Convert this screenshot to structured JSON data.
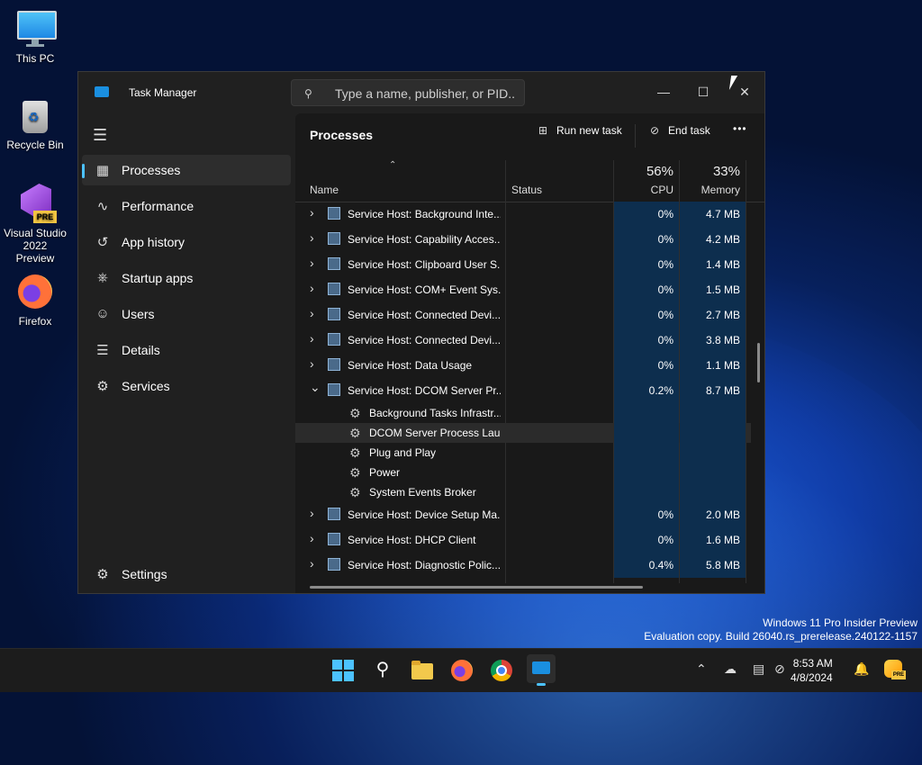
{
  "desktop": {
    "icons": [
      {
        "label": "This PC"
      },
      {
        "label": "Recycle Bin"
      },
      {
        "label_line1": "Visual Studio",
        "label_line2": "2022 Preview",
        "badge": "PRE"
      },
      {
        "label": "Firefox"
      }
    ],
    "watermark": {
      "line1": "Windows 11 Pro Insider Preview",
      "line2": "Evaluation copy. Build 26040.rs_prerelease.240122-1157"
    }
  },
  "window": {
    "title": "Task Manager",
    "search_placeholder": "Type a name, publisher, or PID...",
    "controls": {
      "minimize": "—",
      "maximize": "☐",
      "close": "✕"
    }
  },
  "sidebar": {
    "items": [
      {
        "label": "Processes",
        "icon": "processes-icon",
        "active": true
      },
      {
        "label": "Performance",
        "icon": "performance-icon"
      },
      {
        "label": "App history",
        "icon": "history-icon"
      },
      {
        "label": "Startup apps",
        "icon": "startup-icon"
      },
      {
        "label": "Users",
        "icon": "users-icon"
      },
      {
        "label": "Details",
        "icon": "details-icon"
      },
      {
        "label": "Services",
        "icon": "services-icon"
      }
    ],
    "settings_label": "Settings"
  },
  "main": {
    "title": "Processes",
    "run_new_task": "Run new task",
    "end_task": "End task",
    "more": "•••",
    "columns": {
      "name": "Name",
      "status": "Status",
      "cpu_percent": "56%",
      "cpu": "CPU",
      "mem_percent": "33%",
      "memory": "Memory"
    },
    "rows": [
      {
        "kind": "parent",
        "expanded": false,
        "name": "Service Host: Background Inte...",
        "cpu": "0%",
        "memory": "4.7 MB"
      },
      {
        "kind": "parent",
        "expanded": false,
        "name": "Service Host: Capability Acces...",
        "cpu": "0%",
        "memory": "4.2 MB"
      },
      {
        "kind": "parent",
        "expanded": false,
        "name": "Service Host: Clipboard User S...",
        "cpu": "0%",
        "memory": "1.4 MB"
      },
      {
        "kind": "parent",
        "expanded": false,
        "name": "Service Host: COM+ Event Sys...",
        "cpu": "0%",
        "memory": "1.5 MB"
      },
      {
        "kind": "parent",
        "expanded": false,
        "name": "Service Host: Connected Devi...",
        "cpu": "0%",
        "memory": "2.7 MB"
      },
      {
        "kind": "parent",
        "expanded": false,
        "name": "Service Host: Connected Devi...",
        "cpu": "0%",
        "memory": "3.8 MB"
      },
      {
        "kind": "parent",
        "expanded": false,
        "name": "Service Host: Data Usage",
        "cpu": "0%",
        "memory": "1.1 MB"
      },
      {
        "kind": "parent",
        "expanded": true,
        "name": "Service Host: DCOM Server Pr...",
        "cpu": "0.2%",
        "memory": "8.7 MB"
      },
      {
        "kind": "child",
        "name": "Background Tasks Infrastr...",
        "cpu": "",
        "memory": ""
      },
      {
        "kind": "child",
        "selected": true,
        "name": "DCOM Server Process Lau...",
        "cpu": "",
        "memory": ""
      },
      {
        "kind": "child",
        "name": "Plug and Play",
        "cpu": "",
        "memory": ""
      },
      {
        "kind": "child",
        "name": "Power",
        "cpu": "",
        "memory": ""
      },
      {
        "kind": "child",
        "name": "System Events Broker",
        "cpu": "",
        "memory": ""
      },
      {
        "kind": "parent",
        "expanded": false,
        "name": "Service Host: Device Setup Ma...",
        "cpu": "0%",
        "memory": "2.0 MB"
      },
      {
        "kind": "parent",
        "expanded": false,
        "name": "Service Host: DHCP Client",
        "cpu": "0%",
        "memory": "1.6 MB"
      },
      {
        "kind": "parent",
        "expanded": false,
        "name": "Service Host: Diagnostic Polic...",
        "cpu": "0.4%",
        "memory": "5.8 MB"
      }
    ]
  },
  "taskbar": {
    "apps": [
      "start-icon",
      "search-icon",
      "file-explorer-icon",
      "firefox-icon",
      "chrome-icon",
      "task-manager-icon"
    ],
    "clock_time": "8:53 AM",
    "clock_date": "4/8/2024"
  },
  "colors": {
    "accent": "#4cc2ff",
    "heat": "#0d2e4e",
    "window_bg": "#202020"
  }
}
